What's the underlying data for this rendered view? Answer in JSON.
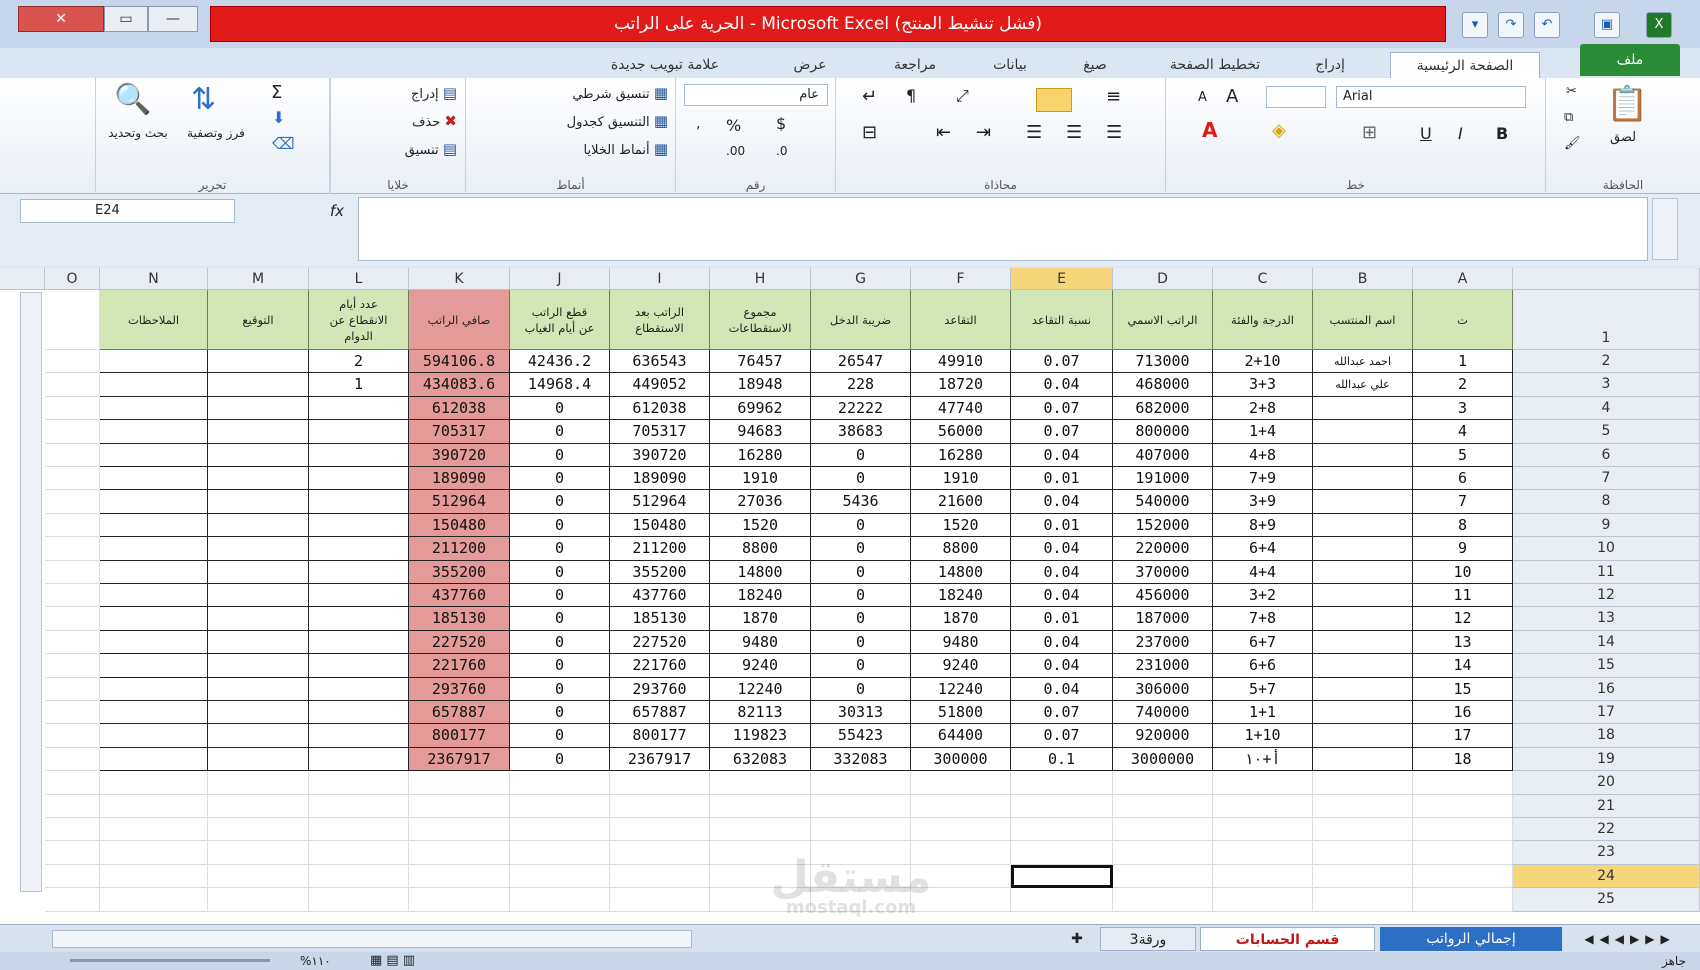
{
  "window": {
    "title": "الحرية على الراتب - Microsoft Excel (فشل تنشيط المنتج)",
    "close_icon": "close-icon",
    "restore_icon": "restore-icon",
    "minimize_icon": "minimize-icon"
  },
  "quick_access": [
    "save-icon",
    "undo-icon",
    "redo-icon",
    "excel-icon"
  ],
  "ribbon_tabs": [
    "الصفحة الرئيسية",
    "إدراج",
    "تخطيط الصفحة",
    "صيغ",
    "بيانات",
    "مراجعة",
    "عرض",
    "علامة تبويب جديدة"
  ],
  "file_tab": "ملف",
  "ribbon": {
    "clipboard": {
      "label": "الحافظة",
      "paste": "لصق"
    },
    "font": {
      "label": "خط",
      "font_name": "Arial",
      "bold": "B",
      "italic": "I",
      "underline": "U",
      "grow": "A",
      "shrink": "A"
    },
    "alignment": {
      "label": "محاذاة"
    },
    "number": {
      "label": "رقم",
      "format": "عام",
      "percent": "%"
    },
    "styles": {
      "label": "أنماط",
      "conditional": "تنسيق شرطي",
      "as_table": "التنسيق كجدول",
      "cell_styles": "أنماط الخلايا"
    },
    "cells": {
      "label": "خلايا",
      "insert": "إدراج",
      "delete": "حذف",
      "format": "تنسيق"
    },
    "editing": {
      "label": "تحرير",
      "sigma": "Σ",
      "sort": "فرز وتصفية",
      "find": "بحث وتحديد"
    }
  },
  "formula_bar": {
    "name_box": "E24",
    "fx": "fx",
    "value": ""
  },
  "columns": [
    "A",
    "B",
    "C",
    "D",
    "E",
    "F",
    "G",
    "H",
    "I",
    "J",
    "K",
    "L",
    "M",
    "N",
    "O"
  ],
  "header_row": {
    "A": "ت",
    "B": "اسم المنتسب",
    "C": "الدرجة والفئة",
    "D": "الراتب الاسمي",
    "E": "نسبة التقاعد",
    "F": "التقاعد",
    "G": "ضريبة الدخل",
    "H": "مجموع\nالاستقطاعات",
    "I": "الراتب بعد\nالاستقطاع",
    "J": "قطع الراتب\nعن أيام الغياب",
    "K": "صافي الراتب",
    "L": "عدد أيام\nالانقطاع عن\nالدوام",
    "M": "التوقيع",
    "N": "الملاحظات"
  },
  "rows": [
    {
      "A": "1",
      "B": "احمد عبدالله",
      "C": "2+10",
      "D": "713000",
      "E": "0.07",
      "F": "49910",
      "G": "26547",
      "H": "76457",
      "I": "636543",
      "J": "42436.2",
      "K": "594106.8",
      "L": "2"
    },
    {
      "A": "2",
      "B": "علي عبدالله",
      "C": "3+3",
      "D": "468000",
      "E": "0.04",
      "F": "18720",
      "G": "228",
      "H": "18948",
      "I": "449052",
      "J": "14968.4",
      "K": "434083.6",
      "L": "1"
    },
    {
      "A": "3",
      "B": "",
      "C": "2+8",
      "D": "682000",
      "E": "0.07",
      "F": "47740",
      "G": "22222",
      "H": "69962",
      "I": "612038",
      "J": "0",
      "K": "612038",
      "L": ""
    },
    {
      "A": "4",
      "B": "",
      "C": "1+4",
      "D": "800000",
      "E": "0.07",
      "F": "56000",
      "G": "38683",
      "H": "94683",
      "I": "705317",
      "J": "0",
      "K": "705317",
      "L": ""
    },
    {
      "A": "5",
      "B": "",
      "C": "4+8",
      "D": "407000",
      "E": "0.04",
      "F": "16280",
      "G": "0",
      "H": "16280",
      "I": "390720",
      "J": "0",
      "K": "390720",
      "L": ""
    },
    {
      "A": "6",
      "B": "",
      "C": "7+9",
      "D": "191000",
      "E": "0.01",
      "F": "1910",
      "G": "0",
      "H": "1910",
      "I": "189090",
      "J": "0",
      "K": "189090",
      "L": ""
    },
    {
      "A": "7",
      "B": "",
      "C": "3+9",
      "D": "540000",
      "E": "0.04",
      "F": "21600",
      "G": "5436",
      "H": "27036",
      "I": "512964",
      "J": "0",
      "K": "512964",
      "L": ""
    },
    {
      "A": "8",
      "B": "",
      "C": "8+9",
      "D": "152000",
      "E": "0.01",
      "F": "1520",
      "G": "0",
      "H": "1520",
      "I": "150480",
      "J": "0",
      "K": "150480",
      "L": ""
    },
    {
      "A": "9",
      "B": "",
      "C": "6+4",
      "D": "220000",
      "E": "0.04",
      "F": "8800",
      "G": "0",
      "H": "8800",
      "I": "211200",
      "J": "0",
      "K": "211200",
      "L": ""
    },
    {
      "A": "10",
      "B": "",
      "C": "4+4",
      "D": "370000",
      "E": "0.04",
      "F": "14800",
      "G": "0",
      "H": "14800",
      "I": "355200",
      "J": "0",
      "K": "355200",
      "L": ""
    },
    {
      "A": "11",
      "B": "",
      "C": "3+2",
      "D": "456000",
      "E": "0.04",
      "F": "18240",
      "G": "0",
      "H": "18240",
      "I": "437760",
      "J": "0",
      "K": "437760",
      "L": ""
    },
    {
      "A": "12",
      "B": "",
      "C": "7+8",
      "D": "187000",
      "E": "0.01",
      "F": "1870",
      "G": "0",
      "H": "1870",
      "I": "185130",
      "J": "0",
      "K": "185130",
      "L": ""
    },
    {
      "A": "13",
      "B": "",
      "C": "6+7",
      "D": "237000",
      "E": "0.04",
      "F": "9480",
      "G": "0",
      "H": "9480",
      "I": "227520",
      "J": "0",
      "K": "227520",
      "L": ""
    },
    {
      "A": "14",
      "B": "",
      "C": "6+6",
      "D": "231000",
      "E": "0.04",
      "F": "9240",
      "G": "0",
      "H": "9240",
      "I": "221760",
      "J": "0",
      "K": "221760",
      "L": ""
    },
    {
      "A": "15",
      "B": "",
      "C": "5+7",
      "D": "306000",
      "E": "0.04",
      "F": "12240",
      "G": "0",
      "H": "12240",
      "I": "293760",
      "J": "0",
      "K": "293760",
      "L": ""
    },
    {
      "A": "16",
      "B": "",
      "C": "1+1",
      "D": "740000",
      "E": "0.07",
      "F": "51800",
      "G": "30313",
      "H": "82113",
      "I": "657887",
      "J": "0",
      "K": "657887",
      "L": ""
    },
    {
      "A": "17",
      "B": "",
      "C": "1+10",
      "D": "920000",
      "E": "0.07",
      "F": "64400",
      "G": "55423",
      "H": "119823",
      "I": "800177",
      "J": "0",
      "K": "800177",
      "L": ""
    },
    {
      "A": "18",
      "B": "",
      "C": "أ+١٠",
      "D": "3000000",
      "E": "0.1",
      "F": "300000",
      "G": "332083",
      "H": "632083",
      "I": "2367917",
      "J": "0",
      "K": "2367917",
      "L": ""
    }
  ],
  "row_numbers": [
    "1",
    "2",
    "3",
    "4",
    "5",
    "6",
    "7",
    "8",
    "9",
    "10",
    "11",
    "12",
    "13",
    "14",
    "15",
    "16",
    "17",
    "18",
    "19",
    "20",
    "21",
    "22",
    "23",
    "24",
    "25"
  ],
  "sheet_tabs": [
    "إجمالي الرواتب",
    "قسم الحسابات",
    "ورقة3"
  ],
  "status": {
    "ready": "جاهز",
    "zoom": "%١١٠"
  },
  "watermark": {
    "line1": "مستقل",
    "line2": "mostaql.com"
  },
  "colors": {
    "header_green": "#d3e6b5",
    "net_salary_red": "#e59a9a",
    "title_red": "#e11a1a",
    "file_tab_green": "#2a8a35",
    "selected_header": "#f5d67a"
  }
}
